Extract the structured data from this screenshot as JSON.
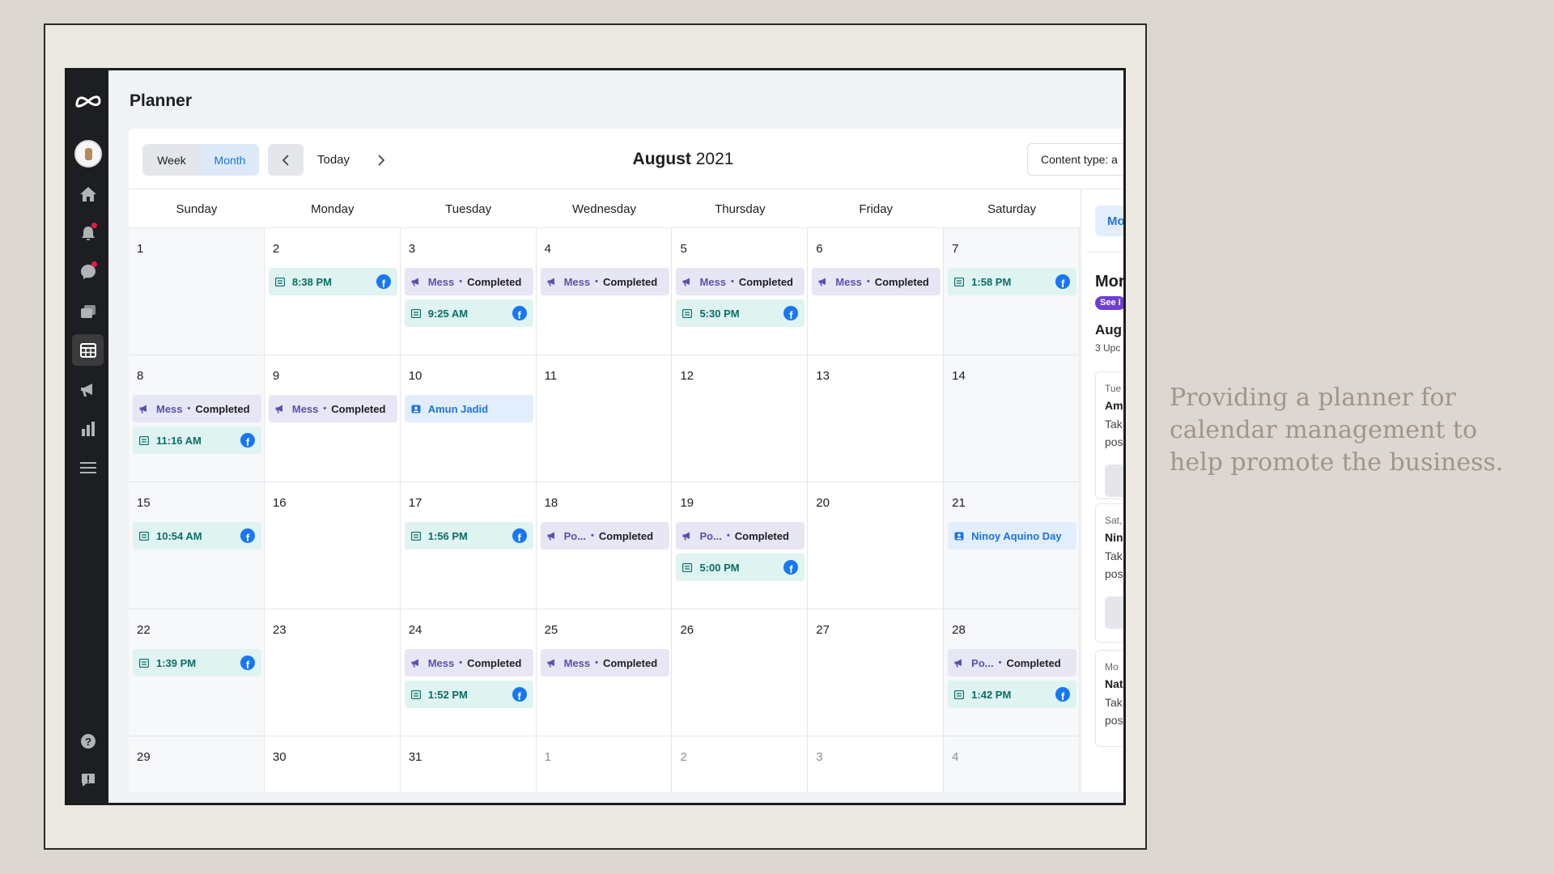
{
  "app": {
    "title": "Planner"
  },
  "toolbar": {
    "week_label": "Week",
    "month_label": "Month",
    "active_view": "Month",
    "today_label": "Today",
    "month_name": "August",
    "year": "2021",
    "content_type_label": "Content type: a"
  },
  "weekdays": [
    "Sunday",
    "Monday",
    "Tuesday",
    "Wednesday",
    "Thursday",
    "Friday",
    "Saturday"
  ],
  "weeks": [
    [
      {
        "day": "1",
        "events": []
      },
      {
        "day": "2",
        "events": [
          {
            "kind": "post",
            "label": "8:38 PM",
            "fb": true
          }
        ]
      },
      {
        "day": "3",
        "events": [
          {
            "kind": "ad",
            "label": "Mess",
            "status": "Completed"
          },
          {
            "kind": "post",
            "label": "9:25 AM",
            "fb": true
          }
        ]
      },
      {
        "day": "4",
        "events": [
          {
            "kind": "ad",
            "label": "Mess",
            "status": "Completed"
          }
        ]
      },
      {
        "day": "5",
        "events": [
          {
            "kind": "ad",
            "label": "Mess",
            "status": "Completed"
          },
          {
            "kind": "post",
            "label": "5:30 PM",
            "fb": true
          }
        ]
      },
      {
        "day": "6",
        "events": [
          {
            "kind": "ad",
            "label": "Mess",
            "status": "Completed"
          }
        ]
      },
      {
        "day": "7",
        "events": [
          {
            "kind": "post",
            "label": "1:58 PM",
            "fb": true
          }
        ]
      }
    ],
    [
      {
        "day": "8",
        "events": [
          {
            "kind": "ad",
            "label": "Mess",
            "status": "Completed"
          },
          {
            "kind": "post",
            "label": "11:16 AM",
            "fb": true
          }
        ]
      },
      {
        "day": "9",
        "events": [
          {
            "kind": "ad",
            "label": "Mess",
            "status": "Completed"
          }
        ]
      },
      {
        "day": "10",
        "events": [
          {
            "kind": "cal",
            "label": "Amun Jadid"
          }
        ]
      },
      {
        "day": "11",
        "events": []
      },
      {
        "day": "12",
        "events": []
      },
      {
        "day": "13",
        "events": []
      },
      {
        "day": "14",
        "events": []
      }
    ],
    [
      {
        "day": "15",
        "events": [
          {
            "kind": "post",
            "label": "10:54 AM",
            "fb": true
          }
        ]
      },
      {
        "day": "16",
        "events": []
      },
      {
        "day": "17",
        "events": [
          {
            "kind": "post",
            "label": "1:56 PM",
            "fb": true
          }
        ]
      },
      {
        "day": "18",
        "events": [
          {
            "kind": "ad",
            "label": "Po...",
            "status": "Completed"
          }
        ]
      },
      {
        "day": "19",
        "events": [
          {
            "kind": "ad",
            "label": "Po...",
            "status": "Completed"
          },
          {
            "kind": "post",
            "label": "5:00 PM",
            "fb": true
          }
        ]
      },
      {
        "day": "20",
        "events": []
      },
      {
        "day": "21",
        "events": [
          {
            "kind": "cal",
            "label": "Ninoy Aquino Day"
          }
        ]
      }
    ],
    [
      {
        "day": "22",
        "events": [
          {
            "kind": "post",
            "label": "1:39 PM",
            "fb": true
          }
        ]
      },
      {
        "day": "23",
        "events": []
      },
      {
        "day": "24",
        "events": [
          {
            "kind": "ad",
            "label": "Mess",
            "status": "Completed"
          },
          {
            "kind": "post",
            "label": "1:52 PM",
            "fb": true
          }
        ]
      },
      {
        "day": "25",
        "events": [
          {
            "kind": "ad",
            "label": "Mess",
            "status": "Completed"
          }
        ]
      },
      {
        "day": "26",
        "events": []
      },
      {
        "day": "27",
        "events": []
      },
      {
        "day": "28",
        "events": [
          {
            "kind": "ad",
            "label": "Po...",
            "status": "Completed"
          },
          {
            "kind": "post",
            "label": "1:42 PM",
            "fb": true
          }
        ]
      }
    ],
    [
      {
        "day": "29",
        "events": []
      },
      {
        "day": "30",
        "events": []
      },
      {
        "day": "31",
        "events": []
      },
      {
        "day": "1",
        "muted": true,
        "events": []
      },
      {
        "day": "2",
        "muted": true,
        "events": []
      },
      {
        "day": "3",
        "muted": true,
        "events": []
      },
      {
        "day": "4",
        "muted": true,
        "events": []
      }
    ]
  ],
  "right_panel": {
    "tab_label": "Mo",
    "heading": "Mor",
    "pill": "See I",
    "month": "Aug",
    "count": "3 Upc",
    "cards": [
      {
        "date": "Tue",
        "title": "Am",
        "line1": "Tak",
        "line2": "pos"
      },
      {
        "date": "Sat,",
        "title": "Nin",
        "line1": "Tak",
        "line2": "pos"
      },
      {
        "date": "Mo",
        "title": "Nat",
        "line1": "Tak",
        "line2": "pos"
      }
    ]
  },
  "caption": "Providing a planner for calendar management to help promote the business.",
  "icons": {
    "nav": [
      "meta-logo-icon",
      "avatar",
      "home-icon",
      "notifications-icon",
      "messages-icon",
      "content-icon",
      "planner-icon",
      "ads-icon",
      "insights-icon",
      "menu-icon",
      "help-icon",
      "report-icon"
    ]
  },
  "colors": {
    "sidebar": "#1c1e21",
    "accent": "#1b74e4",
    "post_bg": "#dff3f1",
    "post_text": "#0a6d68",
    "ad_bg": "#e7e6f5",
    "ad_text": "#5a50b0",
    "facebook": "#1877f2"
  }
}
